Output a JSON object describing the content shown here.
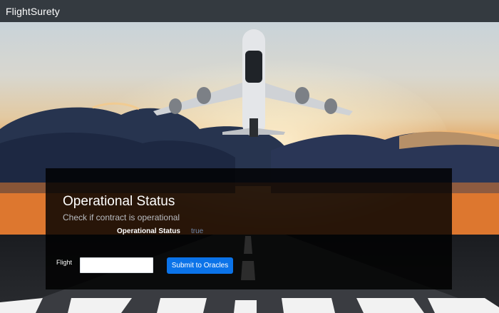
{
  "navbar": {
    "brand": "FlightSurety"
  },
  "status": {
    "title": "Operational Status",
    "subtitle": "Check if contract is operational",
    "label": "Operational Status",
    "value": "true"
  },
  "form": {
    "flight_label": "Flight",
    "flight_input_value": "",
    "submit_label": "Submit to Oracles"
  },
  "colors": {
    "navbar_bg": "#343a40",
    "button_bg": "#0b73e8",
    "status_value": "#6f87a8",
    "panel_bg": "rgba(0,0,0,0.82)"
  },
  "background": {
    "image": "airliner-taking-off-over-runway-at-sunset"
  }
}
